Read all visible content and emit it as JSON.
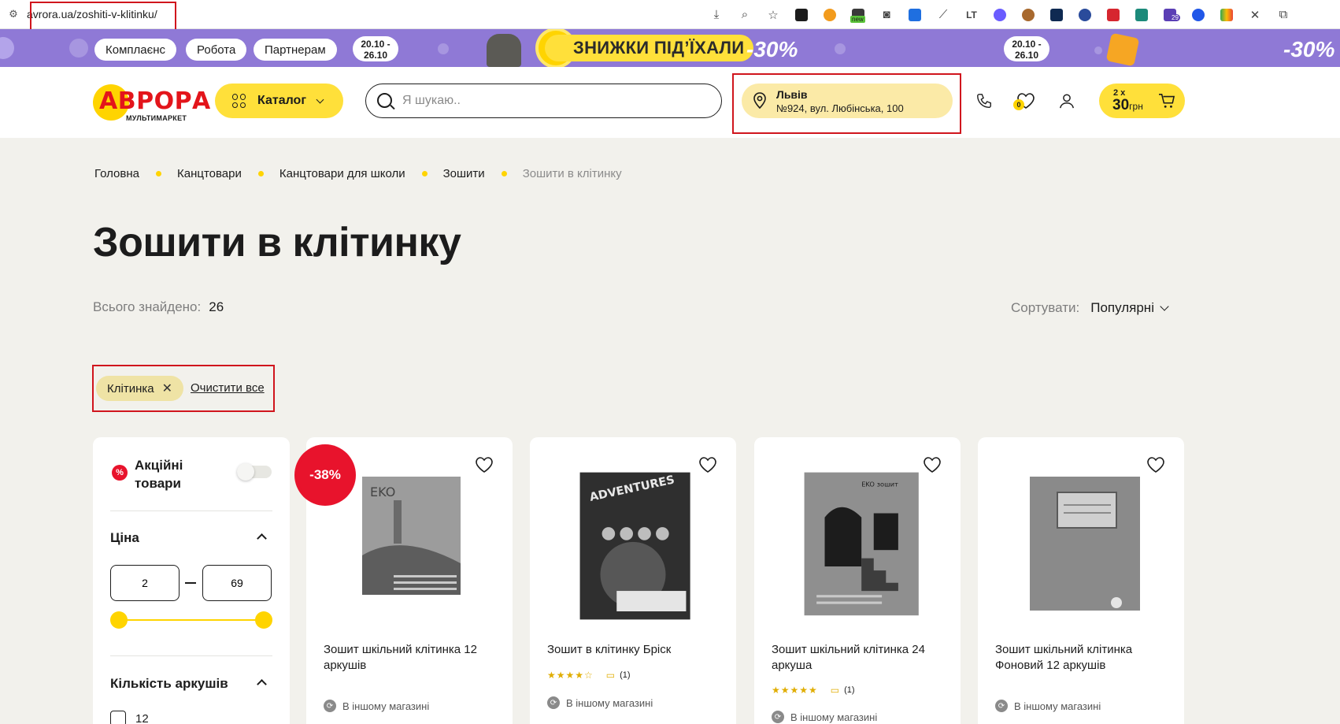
{
  "browser": {
    "url": "avrora.ua/zoshiti-v-klitinku/",
    "extension_badge_new": "new",
    "extension_badge_count": "29"
  },
  "promo": {
    "pills": [
      "Комплаєнс",
      "Робота",
      "Партнерам"
    ],
    "date_left": "20.10 -\n26.10",
    "date_right": "20.10 -\n26.10",
    "headline": "ЗНИЖКИ ПІДʼЇХАЛИ",
    "percent": "-30%",
    "percent_right": "-30%"
  },
  "header": {
    "logo_text": "АВРОРА",
    "logo_sub": "МУЛЬТИМАРКЕТ",
    "catalog_label": "Каталог",
    "search_placeholder": "Я шукаю..",
    "location_city": "Львів",
    "location_address": "№924, вул. Любінська, 100",
    "favorites_count": "0",
    "cart_qty": "2 х",
    "cart_sum": "30",
    "cart_currency": "грн"
  },
  "breadcrumb": [
    "Головна",
    "Канцтовари",
    "Канцтовари для школи",
    "Зошити",
    "Зошити в клітинку"
  ],
  "page_title": "Зошити в клітинку",
  "found": {
    "label": "Всього знайдено:",
    "count": "26"
  },
  "sort": {
    "label": "Сортувати:",
    "value": "Популярні"
  },
  "active_filters": {
    "chip": "Клітинка",
    "clear_all": "Очистити все"
  },
  "filters": {
    "promo_label": "Акційні товари",
    "promo_badge": "%",
    "price_title": "Ціна",
    "price_min": "2",
    "price_max": "69",
    "sheets_title": "Кількість аркушів",
    "sheets_options": [
      "12"
    ]
  },
  "products": [
    {
      "name": "Зошит шкільний клітинка 12 аркушів",
      "badge": "-38%",
      "rating": null,
      "reviews": null,
      "stock": "В іншому магазині"
    },
    {
      "name": "Зошит в клітинку Бріск",
      "badge": null,
      "rating": "★★★★☆",
      "reviews": "(1)",
      "stock": "В іншому магазині"
    },
    {
      "name": "Зошит шкільний клітинка 24 аркуша",
      "badge": null,
      "rating": "★★★★★",
      "reviews": "(1)",
      "stock": "В іншому магазині"
    },
    {
      "name": "Зошит шкільний клітинка Фоновий 12 аркушів",
      "badge": null,
      "rating": null,
      "reviews": null,
      "stock": "В іншому магазині"
    }
  ],
  "colors": {
    "accent": "#ffd400",
    "accent_soft": "#ffe03a",
    "promo_bg": "#8f79d6",
    "sale": "#e8132c",
    "page_bg": "#f2f1ec",
    "highlight_box": "#d0151d"
  },
  "icons": [
    "site-info-icon",
    "install-icon",
    "zoom-icon",
    "star-icon",
    "close-icon",
    "extensions-icon",
    "grid-icon",
    "chevron-down-icon",
    "search-icon",
    "pin-icon",
    "phone-icon",
    "heart-icon",
    "user-icon",
    "cart-icon",
    "close-icon",
    "chevron-up-icon",
    "review-icon",
    "store-icon"
  ]
}
